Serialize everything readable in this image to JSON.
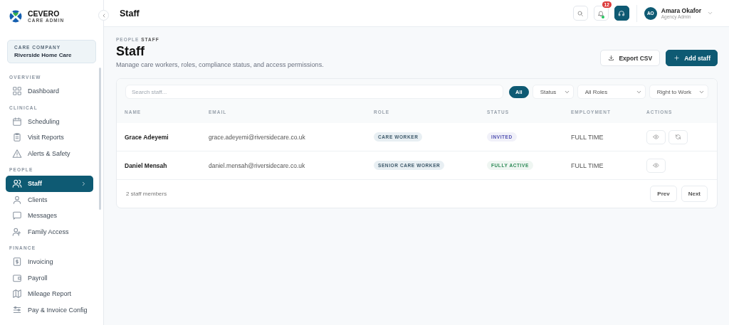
{
  "brand": {
    "name": "CEVERO",
    "tagline": "CARE ADMIN"
  },
  "company": {
    "label": "CARE COMPANY",
    "name": "Riverside Home Care"
  },
  "sidebar": {
    "sections": [
      {
        "title": "OVERVIEW",
        "items": [
          {
            "label": "Dashboard",
            "selected": false
          }
        ]
      },
      {
        "title": "CLINICAL",
        "items": [
          {
            "label": "Scheduling",
            "selected": false
          },
          {
            "label": "Visit Reports",
            "selected": false
          },
          {
            "label": "Alerts & Safety",
            "selected": false
          }
        ]
      },
      {
        "title": "PEOPLE",
        "items": [
          {
            "label": "Staff",
            "selected": true
          },
          {
            "label": "Clients",
            "selected": false
          },
          {
            "label": "Messages",
            "selected": false
          },
          {
            "label": "Family Access",
            "selected": false
          }
        ]
      },
      {
        "title": "FINANCE",
        "items": [
          {
            "label": "Invoicing",
            "selected": false
          },
          {
            "label": "Payroll",
            "selected": false
          },
          {
            "label": "Mileage Report",
            "selected": false
          },
          {
            "label": "Pay & Invoice Config",
            "selected": false
          }
        ]
      }
    ]
  },
  "topbar": {
    "title": "Staff",
    "notifications": "12",
    "user": {
      "initials": "AO",
      "name": "Amara Okafor",
      "role": "Agency Admin"
    }
  },
  "page": {
    "breadcrumb": [
      "PEOPLE",
      "STAFF"
    ],
    "title": "Staff",
    "subtitle": "Manage care workers, roles, compliance status, and access permissions.",
    "buttons": [
      {
        "label": "Export CSV",
        "kind": "secondary"
      },
      {
        "label": "Add staff",
        "kind": "primary"
      }
    ]
  },
  "search": {
    "placeholder": "Search staff..."
  },
  "filters": [
    {
      "label": "All",
      "kind": "chip",
      "selected": true
    },
    {
      "label": "Status",
      "kind": "select"
    },
    {
      "label": "All Roles",
      "kind": "select"
    },
    {
      "label": "Right to Work",
      "kind": "select"
    }
  ],
  "table": {
    "columns": [
      "NAME",
      "EMAIL",
      "ROLE",
      "STATUS",
      "EMPLOYMENT",
      "ACTIONS"
    ],
    "rows": [
      {
        "name": "Grace Adeyemi",
        "email": "grace.adeyemi@riversidecare.co.uk",
        "role": "CARE WORKER",
        "status": {
          "label": "INVITED",
          "color": "#4f4fb0"
        },
        "employment": "FULL TIME",
        "actions": [
          {
            "kind": "view"
          },
          {
            "kind": "resend"
          }
        ]
      },
      {
        "name": "Daniel Mensah",
        "email": "daniel.mensah@riversidecare.co.uk",
        "role": "SENIOR CARE WORKER",
        "status": {
          "label": "FULLY ACTIVE",
          "color": "#2e8b57"
        },
        "employment": "FULL TIME",
        "actions": [
          {
            "kind": "view"
          }
        ]
      }
    ]
  },
  "footer": {
    "count": "2 staff members",
    "buttons": [
      "Prev",
      "Next"
    ]
  }
}
